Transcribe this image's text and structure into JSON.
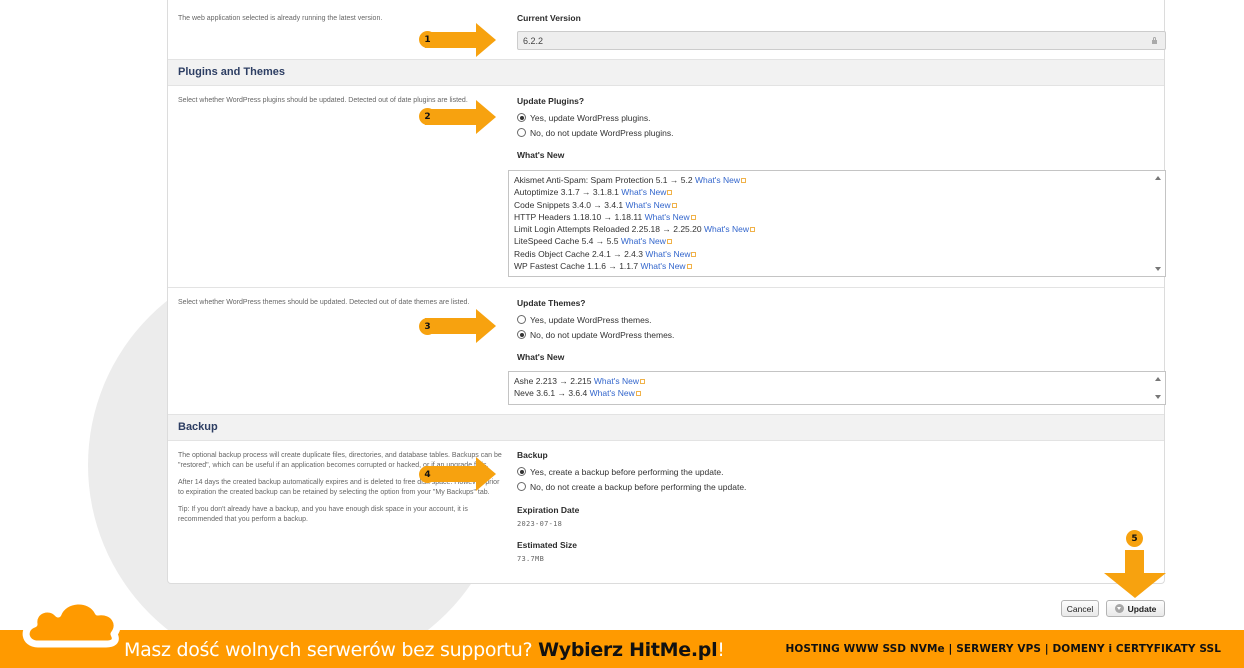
{
  "version": {
    "description": "The web application selected is already running the latest version.",
    "label": "Current Version",
    "value": "6.2.2"
  },
  "plugins_themes": {
    "header": "Plugins and Themes",
    "plugins": {
      "description": "Select whether WordPress plugins should be updated. Detected out of date plugins are listed.",
      "label": "Update Plugins?",
      "options": [
        "Yes, update WordPress plugins.",
        "No, do not update WordPress plugins."
      ],
      "selected_index": 0,
      "whats_new_label": "What's New",
      "items": [
        {
          "text": "Akismet Anti-Spam: Spam Protection 5.1 → 5.2",
          "link": "What's New"
        },
        {
          "text": "Autoptimize 3.1.7 → 3.1.8.1",
          "link": "What's New"
        },
        {
          "text": "Code Snippets 3.4.0 → 3.4.1",
          "link": "What's New"
        },
        {
          "text": "HTTP Headers 1.18.10 → 1.18.11",
          "link": "What's New"
        },
        {
          "text": "Limit Login Attempts Reloaded 2.25.18 → 2.25.20",
          "link": "What's New"
        },
        {
          "text": "LiteSpeed Cache 5.4 → 5.5",
          "link": "What's New"
        },
        {
          "text": "Redis Object Cache 2.4.1 → 2.4.3",
          "link": "What's New"
        },
        {
          "text": "WP Fastest Cache 1.1.6 → 1.1.7",
          "link": "What's New"
        }
      ]
    },
    "themes": {
      "description": "Select whether WordPress themes should be updated. Detected out of date themes are listed.",
      "label": "Update Themes?",
      "options": [
        "Yes, update WordPress themes.",
        "No, do not update WordPress themes."
      ],
      "selected_index": 1,
      "whats_new_label": "What's New",
      "items": [
        {
          "text": "Ashe 2.213 → 2.215",
          "link": "What's New"
        },
        {
          "text": "Neve 3.6.1 → 3.6.4",
          "link": "What's New"
        }
      ]
    }
  },
  "backup": {
    "header": "Backup",
    "description_1": "The optional backup process will create duplicate files, directories, and database tables. Backups can be \"restored\", which can be useful if an application becomes corrupted or hacked, or if an upgrade fails.",
    "description_2": "After 14 days the created backup automatically expires and is deleted to free disk space. However, prior to expiration the created backup can be retained by selecting the option from your \"My Backups\" tab.",
    "description_3": "Tip: If you don't already have a backup, and you have enough disk space in your account, it is recommended that you perform a backup.",
    "label": "Backup",
    "options": [
      "Yes, create a backup before performing the update.",
      "No, do not create a backup before performing the update."
    ],
    "selected_index": 0,
    "expiration_label": "Expiration Date",
    "expiration_value": "2023-07-18",
    "size_label": "Estimated Size",
    "size_value": "73.7MB"
  },
  "actions": {
    "cancel": "Cancel",
    "update": "Update"
  },
  "callouts": [
    "1",
    "2",
    "3",
    "4",
    "5"
  ],
  "footer": {
    "promo_text": "Masz dość wolnych serwerów bez supportu? ",
    "promo_bold": "Wybierz HitMe.pl",
    "promo_end": "!",
    "services": "HOSTING WWW SSD NVMe | SERWERY VPS | DOMENY i CERTYFIKATY SSL"
  },
  "colors": {
    "accent_orange": "#f7a20f",
    "footer_orange": "#ff9a00",
    "section_title": "#2d3e63",
    "link": "#3366cc"
  }
}
